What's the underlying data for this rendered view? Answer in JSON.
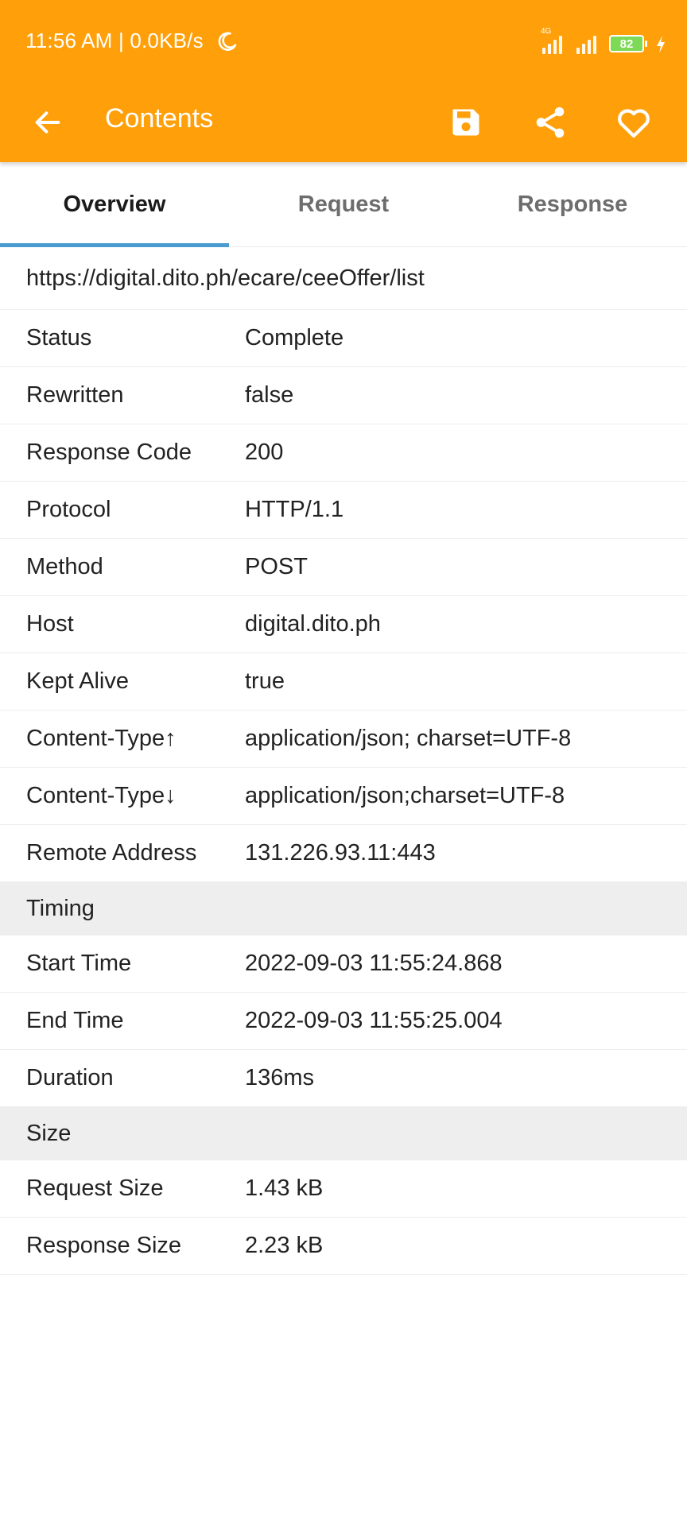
{
  "status_bar": {
    "time": "11:56 AM | 0.0KB/s",
    "network_tag": "4G",
    "battery": "82"
  },
  "app_bar": {
    "title": "Contents"
  },
  "tabs": [
    {
      "label": "Overview",
      "active": true
    },
    {
      "label": "Request",
      "active": false
    },
    {
      "label": "Response",
      "active": false
    }
  ],
  "url": "https://digital.dito.ph/ecare/ceeOffer/list",
  "overview_rows": [
    {
      "label": "Status",
      "value": "Complete"
    },
    {
      "label": "Rewritten",
      "value": "false"
    },
    {
      "label": "Response Code",
      "value": "200"
    },
    {
      "label": "Protocol",
      "value": "HTTP/1.1"
    },
    {
      "label": "Method",
      "value": "POST"
    },
    {
      "label": "Host",
      "value": "digital.dito.ph"
    },
    {
      "label": "Kept Alive",
      "value": "true"
    },
    {
      "label": "Content-Type↑",
      "value": "application/json; charset=UTF-8"
    },
    {
      "label": "Content-Type↓",
      "value": "application/json;charset=UTF-8"
    },
    {
      "label": "Remote Address",
      "value": "131.226.93.11:443"
    }
  ],
  "timing": {
    "header": "Timing",
    "rows": [
      {
        "label": "Start Time",
        "value": "2022-09-03 11:55:24.868"
      },
      {
        "label": "End Time",
        "value": "2022-09-03 11:55:25.004"
      },
      {
        "label": "Duration",
        "value": "136ms"
      }
    ]
  },
  "size": {
    "header": "Size",
    "rows": [
      {
        "label": "Request Size",
        "value": "1.43 kB"
      },
      {
        "label": "Response Size",
        "value": "2.23 kB"
      }
    ]
  },
  "colors": {
    "accent": "#FFA00A",
    "tab_indicator": "#4A9BD0",
    "section_bg": "#EEEEEE",
    "battery": "#7ED957"
  },
  "icons": {
    "back": "arrow-left-icon",
    "save": "floppy-disk-icon",
    "share": "share-icon",
    "favorite": "heart-outline-icon",
    "status": "moon-icon"
  }
}
